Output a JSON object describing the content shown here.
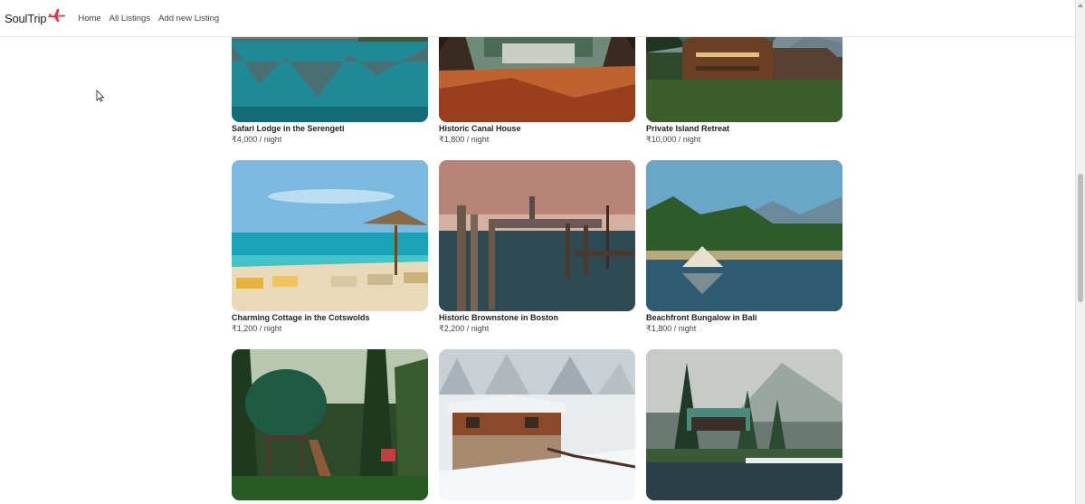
{
  "navbar": {
    "brand": "SoulTrip",
    "brand_icon": "airplane-icon",
    "links": [
      "Home",
      "All Listings",
      "Add new Listing"
    ]
  },
  "listings": [
    {
      "title": "Safari Lodge in the Serengeti",
      "price": "₹4,000 / night",
      "image": "mountain-lake-reflection"
    },
    {
      "title": "Historic Canal House",
      "price": "₹1,800 / night",
      "image": "tent-forest-view"
    },
    {
      "title": "Private Island Retreat",
      "price": "₹10,000 / night",
      "image": "forest-cabin"
    },
    {
      "title": "Charming Cottage in the Cotswolds",
      "price": "₹1,200 / night",
      "image": "beach-umbrellas"
    },
    {
      "title": "Historic Brownstone in Boston",
      "price": "₹2,200 / night",
      "image": "venice-pier"
    },
    {
      "title": "Beachfront Bungalow in Bali",
      "price": "₹1,800 / night",
      "image": "lake-tent"
    },
    {
      "title": "",
      "price": "",
      "image": "treehouse-dome"
    },
    {
      "title": "",
      "price": "",
      "image": "snowy-chalet"
    },
    {
      "title": "",
      "price": "",
      "image": "lakeside-cabin"
    }
  ],
  "colors": {
    "brand_accent": "#e8344e",
    "text": "#222222",
    "nav_text": "#444444"
  }
}
